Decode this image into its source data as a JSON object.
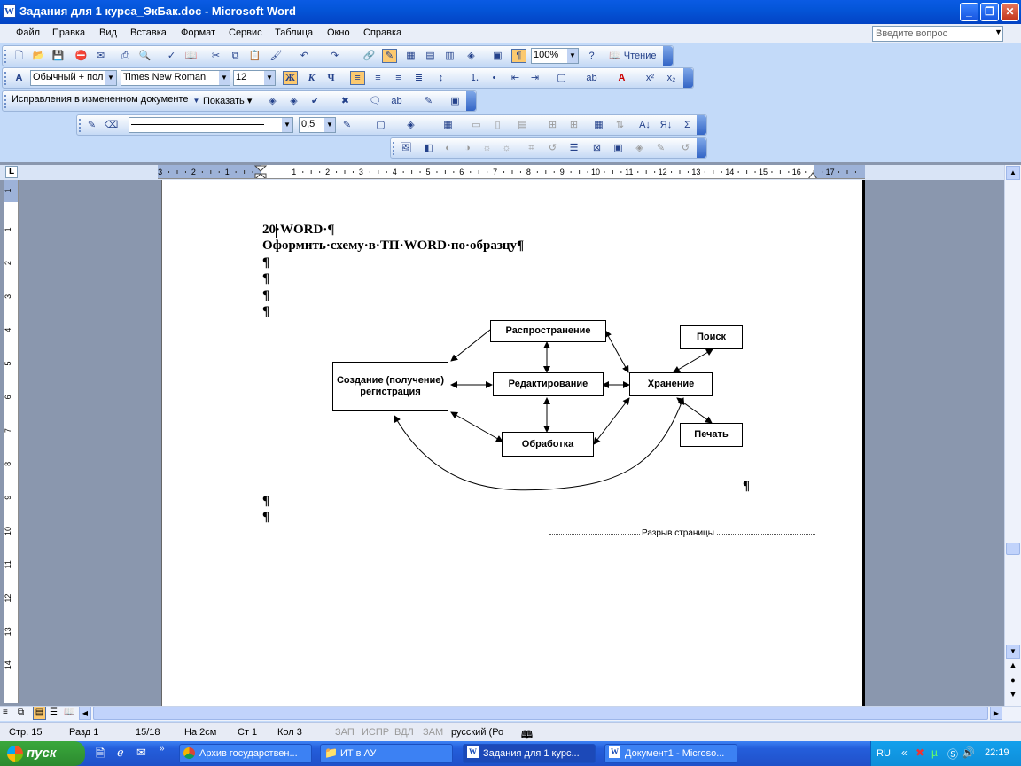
{
  "window": {
    "title": "Задания для 1 курса_ЭкБак.doc - Microsoft Word",
    "app_icon": "W"
  },
  "menu": [
    "Файл",
    "Правка",
    "Вид",
    "Вставка",
    "Формат",
    "Сервис",
    "Таблица",
    "Окно",
    "Справка"
  ],
  "ask": {
    "placeholder": "Введите вопрос"
  },
  "toolbar_standard": {
    "zoom": "100%",
    "reading": "Чтение"
  },
  "toolbar_format": {
    "style": "Обычный + пол",
    "font": "Times New Roman",
    "size": "12",
    "bold": "Ж",
    "italic": "К",
    "underline": "Ч"
  },
  "toolbar_review": {
    "mode": "Исправления в измененном документе",
    "show": "Показать"
  },
  "toolbar_drawing": {
    "line_weight": "0,5"
  },
  "ruler": {
    "h_labels": [
      "3",
      "2",
      "1",
      "1",
      "2",
      "3",
      "4",
      "5",
      "6",
      "7",
      "8",
      "9",
      "10",
      "11",
      "12",
      "13",
      "14",
      "15",
      "16",
      "17"
    ],
    "v_labels": [
      "1",
      "1",
      "2",
      "3",
      "4",
      "5",
      "6",
      "7",
      "8",
      "9",
      "10",
      "11",
      "12",
      "13",
      "14"
    ]
  },
  "document": {
    "line1": "20·WORD·¶",
    "line2": "Оформить·схему·в·ТП·WORD·по·образцу¶",
    "pilcrow": "¶",
    "page_break": "Разрыв страницы"
  },
  "diagram": {
    "create": "Создание (получение) регистрация",
    "distribution": "Распространение",
    "editing": "Редактирование",
    "processing": "Обработка",
    "storage": "Хранение",
    "search": "Поиск",
    "print": "Печать"
  },
  "status": {
    "page": "Стр. 15",
    "section": "Разд 1",
    "pages": "15/18",
    "at": "На 2см",
    "line": "Ст 1",
    "col": "Кол 3",
    "rec": "ЗАП",
    "trk": "ИСПР",
    "ext": "ВДЛ",
    "ovr": "ЗАМ",
    "lang": "русский (Ро"
  },
  "taskbar": {
    "start": "пуск",
    "tasks": [
      "Архив государствен...",
      "ИТ в АУ",
      "Задания для 1 курс...",
      "Документ1 - Microso..."
    ],
    "lang": "RU",
    "clock": "22:19"
  }
}
